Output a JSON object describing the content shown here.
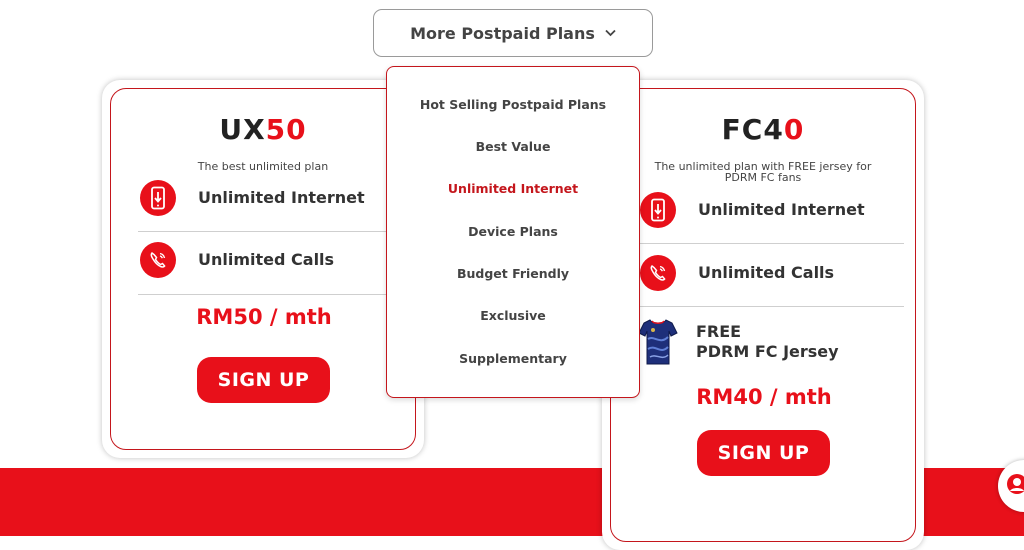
{
  "dropdown": {
    "label": "More Postpaid Plans",
    "items": [
      {
        "label": "Hot Selling Postpaid Plans",
        "active": false
      },
      {
        "label": "Best Value",
        "active": false
      },
      {
        "label": "Unlimited Internet",
        "active": true
      },
      {
        "label": "Device Plans",
        "active": false
      },
      {
        "label": "Budget Friendly",
        "active": false
      },
      {
        "label": "Exclusive",
        "active": false
      },
      {
        "label": "Supplementary",
        "active": false
      }
    ]
  },
  "plans": [
    {
      "title_main": "UX",
      "title_accent": "50",
      "subtitle": "The best unlimited plan",
      "features": [
        "Unlimited Internet",
        "Unlimited Calls"
      ],
      "price": "RM50 / mth",
      "cta": "SIGN UP"
    },
    {
      "title_main": "FC4",
      "title_accent": "0",
      "subtitle_line1": "The unlimited plan with FREE jersey for",
      "subtitle_line2": "PDRM FC fans",
      "features": [
        "Unlimited Internet",
        "Unlimited Calls"
      ],
      "extra_line1": "FREE",
      "extra_line2": "PDRM FC Jersey",
      "price": "RM40 / mth",
      "cta": "SIGN UP"
    }
  ],
  "colors": {
    "brand_red": "#e8101a",
    "border_red": "#c4161c"
  },
  "icons": [
    "chevron-down-icon",
    "phone-internet-icon",
    "phone-call-icon",
    "jersey-icon",
    "chat-icon"
  ]
}
